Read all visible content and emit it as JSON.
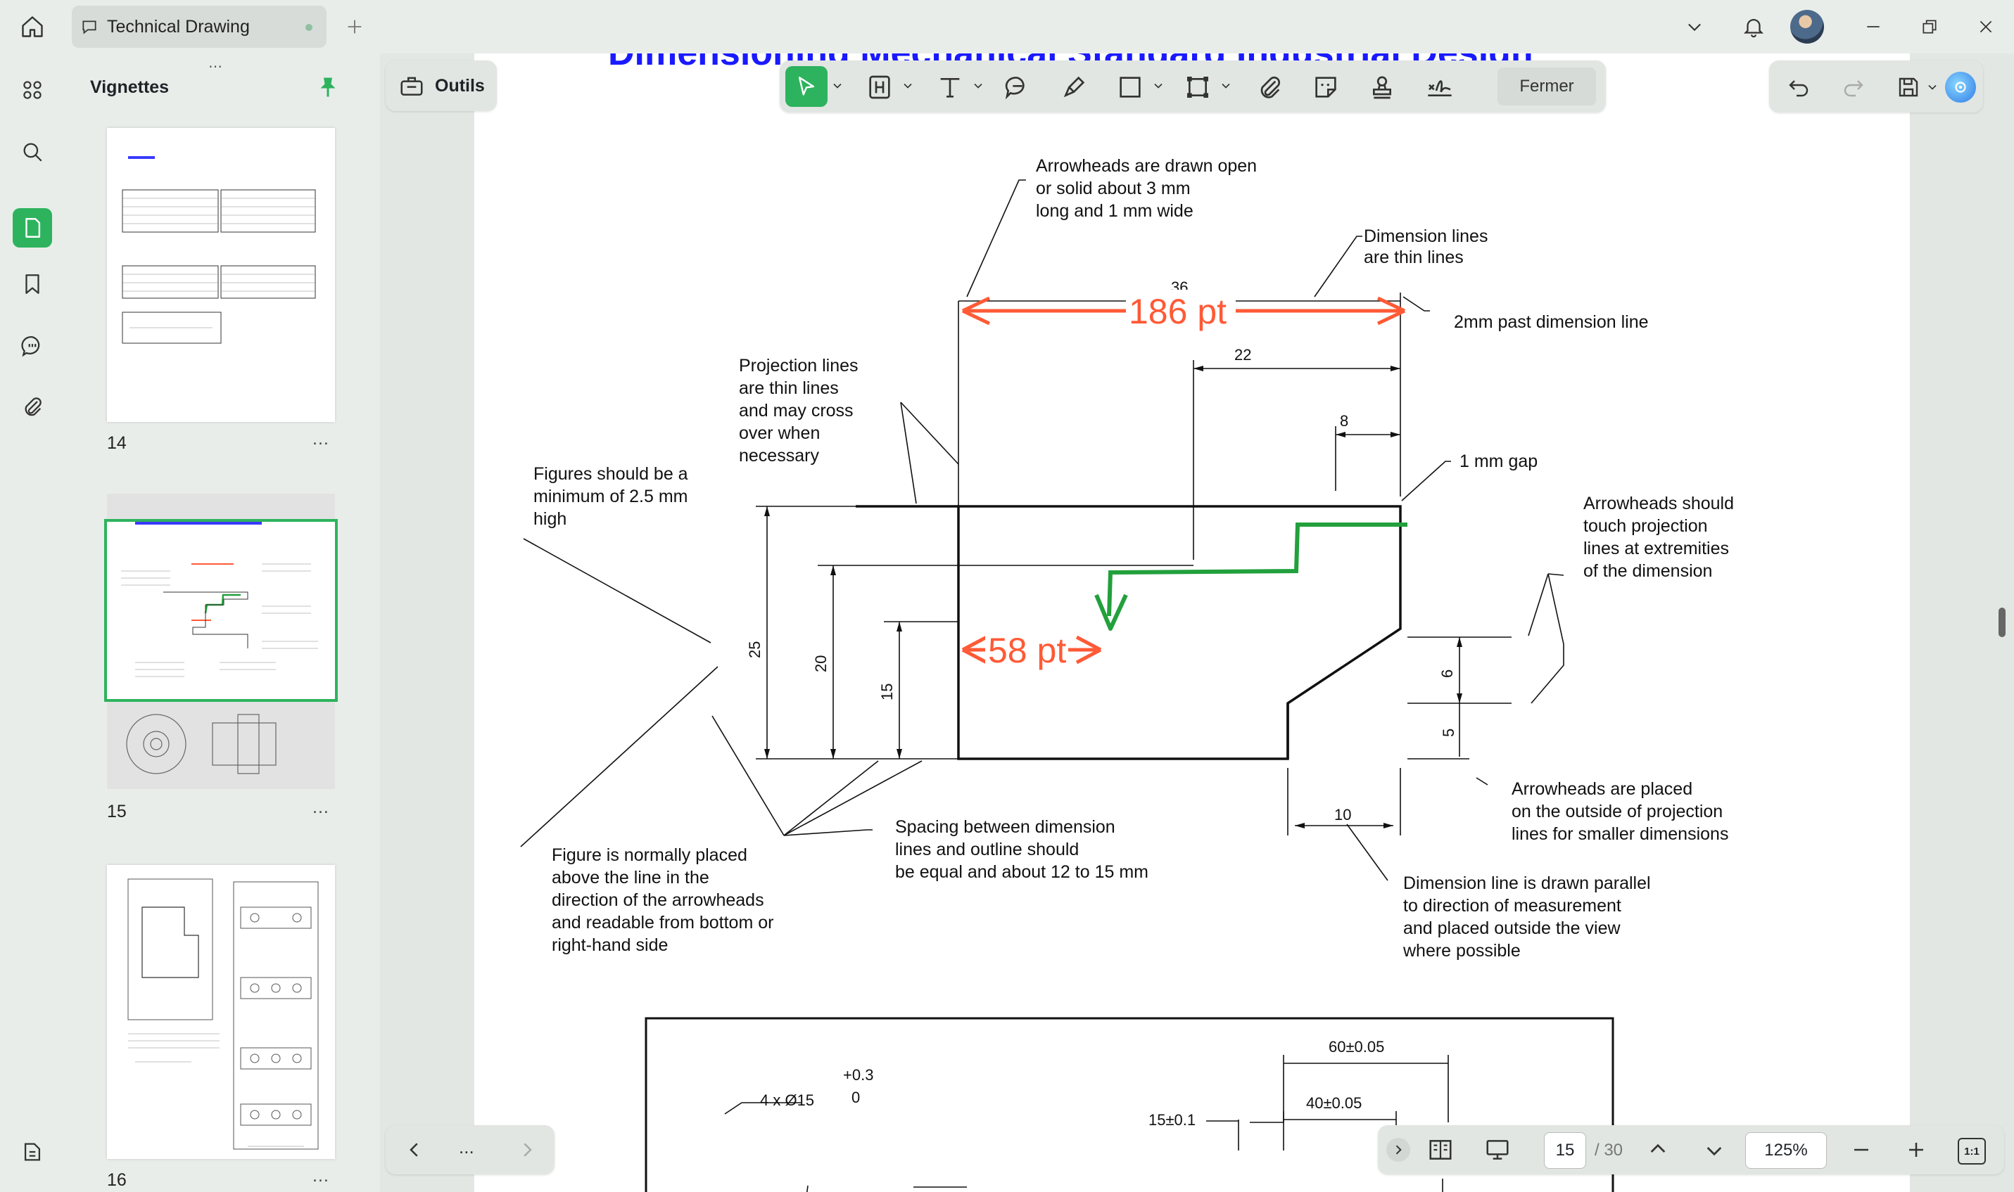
{
  "tab": {
    "title": "Technical Drawing"
  },
  "thumbnails": {
    "title": "Vignettes",
    "pages": [
      {
        "number": "14"
      },
      {
        "number": "15"
      },
      {
        "number": "16"
      }
    ],
    "more_label": "..."
  },
  "toolbar": {
    "tools_label": "Outils",
    "close_label": "Fermer"
  },
  "document": {
    "page_heading": "Dimensioning Mechanical Standard Industrial Design",
    "annotations": {
      "arrowheads_open": [
        "Arrowheads are drawn open",
        "or solid about 3 mm",
        "long and 1 mm wide"
      ],
      "dimension_thin": [
        "Dimension lines",
        "are thin lines"
      ],
      "past_line": "2mm past dimension line",
      "projection_thin": [
        "Projection lines",
        "are thin lines",
        "and may cross",
        "over when",
        "necessary"
      ],
      "gap": "1 mm gap",
      "figures_min": [
        "Figures should be a",
        "minimum of 2.5 mm",
        "high"
      ],
      "arrowheads_touch": [
        "Arrowheads should",
        "touch projection",
        "lines at extremities",
        "of the dimension"
      ],
      "arrowheads_outside": [
        "Arrowheads are placed",
        "on the outside of projection",
        "lines for smaller dimensions"
      ],
      "spacing": [
        "Spacing between dimension",
        "lines and outline should",
        "be equal and about 12 to 15 mm"
      ],
      "figure_placed": [
        "Figure is normally placed",
        "above the line in the",
        "direction of the arrowheads",
        "and readable from bottom or",
        "right-hand side"
      ],
      "parallel": [
        "Dimension line is drawn parallel",
        "to direction of measurement",
        "and placed outside the view",
        "where possible"
      ]
    },
    "dims": {
      "d36": "36",
      "d22": "22",
      "d8": "8",
      "d25": "25",
      "d20": "20",
      "d15": "15",
      "d6": "6",
      "d5": "5",
      "d10": "10"
    },
    "measure_labels": {
      "top": "186 pt",
      "inner": "58 pt"
    },
    "lower_drawing": {
      "tol1": "60±0.05",
      "tol2": "40±0.05",
      "tol3": "15±0.1",
      "holes": "4 x Ø15",
      "upper": "+0.3",
      "lower": "0"
    }
  },
  "status": {
    "page": "15",
    "total": "/ 30",
    "zoom": "125%"
  },
  "colors": {
    "accent": "#2db35d",
    "measure": "#ff5a36",
    "path": "#22a03c",
    "heading": "#1a1aff"
  }
}
